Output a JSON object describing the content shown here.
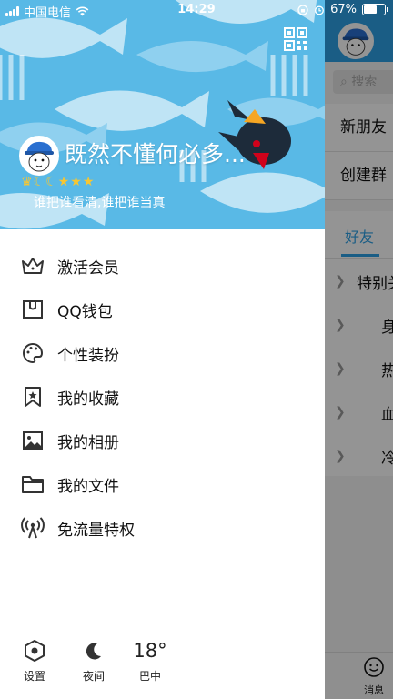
{
  "status_bar": {
    "carrier": "中国电信",
    "time": "14:29",
    "battery": "67%"
  },
  "profile": {
    "nickname": "既然不懂何必多...",
    "level_icons": [
      "crown-icon",
      "moon-icon",
      "moon-icon",
      "star-icon",
      "star-icon",
      "star-icon"
    ],
    "signature": "谁把谁看清,谁把谁当真"
  },
  "menu": [
    {
      "label": "激活会员",
      "icon": "crown-icon"
    },
    {
      "label": "QQ钱包",
      "icon": "wallet-icon"
    },
    {
      "label": "个性装扮",
      "icon": "palette-icon"
    },
    {
      "label": "我的收藏",
      "icon": "bookmark-star-icon"
    },
    {
      "label": "我的相册",
      "icon": "photo-icon"
    },
    {
      "label": "我的文件",
      "icon": "folder-icon"
    },
    {
      "label": "免流量特权",
      "icon": "antenna-icon"
    }
  ],
  "bottom": {
    "settings": "设置",
    "night": "夜间",
    "temperature": "18°",
    "city": "巴中"
  },
  "behind": {
    "search_placeholder": "搜索",
    "new_friends": "新朋友",
    "create_group": "创建群",
    "tab_friends": "好友",
    "groups": [
      "特别关",
      "身",
      "热",
      "血",
      "冷"
    ],
    "messages": "消息"
  },
  "colors": {
    "header_bg": "#59b9e6",
    "accent": "#2ea1e5"
  }
}
